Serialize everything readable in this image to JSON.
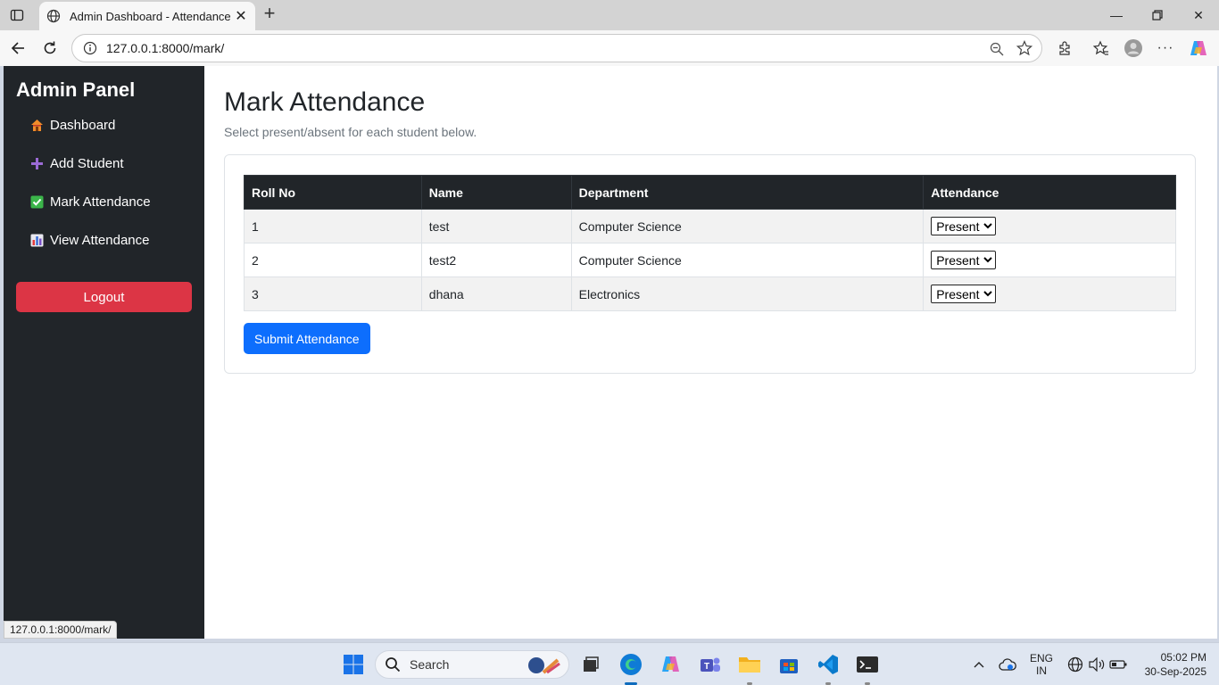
{
  "browser": {
    "tab_title": "Admin Dashboard - Attendance S",
    "url": "127.0.0.1:8000/mark/",
    "status_url": "127.0.0.1:8000/mark/"
  },
  "sidebar": {
    "brand": "Admin Panel",
    "items": [
      {
        "label": "Dashboard",
        "icon": "house-icon"
      },
      {
        "label": "Add Student",
        "icon": "plus-icon"
      },
      {
        "label": "Mark Attendance",
        "icon": "check-box-icon"
      },
      {
        "label": "View Attendance",
        "icon": "bar-chart-icon"
      }
    ],
    "logout_label": "Logout"
  },
  "main": {
    "title": "Mark Attendance",
    "subtitle": "Select present/absent for each student below.",
    "table": {
      "headers": [
        "Roll No",
        "Name",
        "Department",
        "Attendance"
      ],
      "rows": [
        {
          "roll": "1",
          "name": "test",
          "department": "Computer Science",
          "attendance": "Present"
        },
        {
          "roll": "2",
          "name": "test2",
          "department": "Computer Science",
          "attendance": "Present"
        },
        {
          "roll": "3",
          "name": "dhana",
          "department": "Electronics",
          "attendance": "Present"
        }
      ]
    },
    "submit_label": "Submit Attendance"
  },
  "taskbar": {
    "search_placeholder": "Search",
    "lang_line1": "ENG",
    "lang_line2": "IN",
    "time": "05:02 PM",
    "date": "30-Sep-2025"
  },
  "colors": {
    "sidebar_bg": "#212529",
    "logout": "#dc3545",
    "primary": "#0d6efd"
  }
}
